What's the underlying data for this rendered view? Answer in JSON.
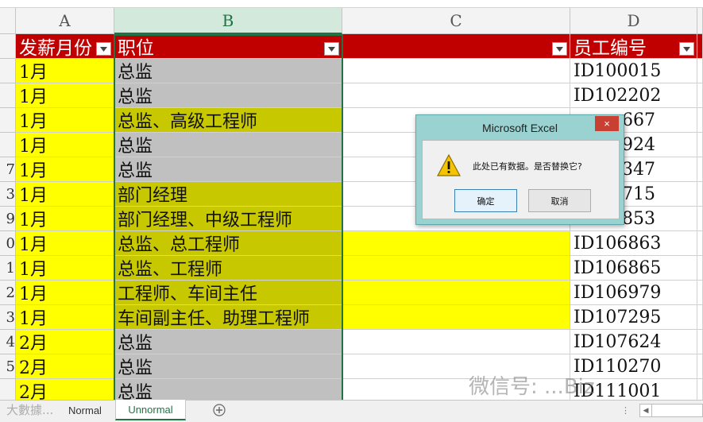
{
  "columns": [
    "A",
    "B",
    "C",
    "D"
  ],
  "row_numbers": [
    "",
    "",
    "",
    "",
    "",
    "7",
    "3",
    "9",
    "0",
    "1",
    "2",
    "3",
    "4",
    "5"
  ],
  "header_row": {
    "a": "发薪月份",
    "b": "职位",
    "c": "",
    "d": "员工编号"
  },
  "rows": [
    {
      "a": "1月",
      "b": "总监",
      "d": "ID100015"
    },
    {
      "a": "1月",
      "b": "总监",
      "d": "ID102202"
    },
    {
      "a": "1月",
      "b": "总监、高级工程师",
      "d": "ID10?667"
    },
    {
      "a": "1月",
      "b": "总监",
      "d": "ID10?924"
    },
    {
      "a": "1月",
      "b": "总监",
      "d": "ID10?347"
    },
    {
      "a": "1月",
      "b": "部门经理",
      "d": "ID10?715"
    },
    {
      "a": "1月",
      "b": "部门经理、中级工程师",
      "d": "ID10?853"
    },
    {
      "a": "1月",
      "b": "总监、总工程师",
      "d": "ID106863"
    },
    {
      "a": "1月",
      "b": "总监、工程师",
      "d": "ID106865"
    },
    {
      "a": "1月",
      "b": "工程师、车间主任",
      "d": "ID106979"
    },
    {
      "a": "1月",
      "b": "车间副主任、助理工程师",
      "d": "ID107295"
    },
    {
      "a": "2月",
      "b": "总监",
      "d": "ID107624"
    },
    {
      "a": "2月",
      "b": "总监",
      "d": "ID110270"
    },
    {
      "a": "2月",
      "b": "总监",
      "d": "ID111001"
    }
  ],
  "d_visible": [
    "ID100015",
    "ID102202",
    "667",
    "924",
    "347",
    "715",
    "853",
    "ID106863",
    "ID106865",
    "ID106979",
    "ID107295",
    "ID107624",
    "ID110270",
    "ID111001"
  ],
  "dialog": {
    "title": "Microsoft Excel",
    "close": "×",
    "message": "此处已有数据。是否替换它?",
    "ok": "确定",
    "cancel": "取消",
    "icon": "warning-icon"
  },
  "tabs": {
    "sheet1": "Normal",
    "sheet2": "Unnormal",
    "add": "+"
  },
  "watermark": {
    "main": "微信号: ...Biz",
    "corner": "大數據..."
  },
  "colors": {
    "header_red": "#c00000",
    "yellow": "#ffff00",
    "olive": "#c8c800",
    "gray": "#c0c0c0",
    "excel_green": "#217346"
  }
}
